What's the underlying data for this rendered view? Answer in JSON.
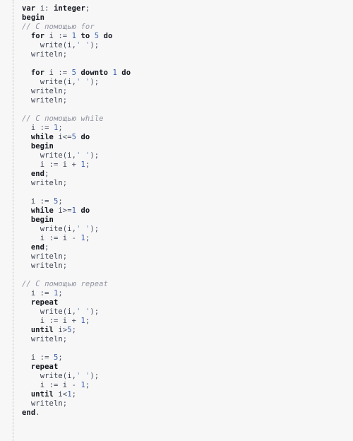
{
  "document": {
    "kind": "code-listing",
    "language": "Pascal",
    "colors": {
      "background": "#f7f7f8",
      "gutter_border": "#b9bcc4",
      "keyword": "#13161d",
      "comment": "#9295a0",
      "number": "#3d5fa6",
      "string": "#6f8dbe",
      "identifier": "#3c4250",
      "punctuation": "#4a5060"
    },
    "lines": [
      {
        "indent": 0,
        "tokens": [
          {
            "t": "var",
            "c": "kw"
          },
          {
            "t": " ",
            "c": "pun"
          },
          {
            "t": "i",
            "c": "id"
          },
          {
            "t": ": ",
            "c": "pun"
          },
          {
            "t": "integer",
            "c": "kw"
          },
          {
            "t": ";",
            "c": "pun"
          }
        ]
      },
      {
        "indent": 0,
        "tokens": [
          {
            "t": "begin",
            "c": "kw"
          }
        ]
      },
      {
        "indent": 0,
        "tokens": [
          {
            "t": "// С помощью for",
            "c": "cm"
          }
        ]
      },
      {
        "indent": 1,
        "tokens": [
          {
            "t": "for",
            "c": "kw"
          },
          {
            "t": " ",
            "c": "pun"
          },
          {
            "t": "i",
            "c": "id"
          },
          {
            "t": " := ",
            "c": "pun"
          },
          {
            "t": "1",
            "c": "num"
          },
          {
            "t": " ",
            "c": "pun"
          },
          {
            "t": "to",
            "c": "kw"
          },
          {
            "t": " ",
            "c": "pun"
          },
          {
            "t": "5",
            "c": "num"
          },
          {
            "t": " ",
            "c": "pun"
          },
          {
            "t": "do",
            "c": "kw"
          }
        ]
      },
      {
        "indent": 2,
        "tokens": [
          {
            "t": "write",
            "c": "id"
          },
          {
            "t": "(",
            "c": "pun"
          },
          {
            "t": "i",
            "c": "id"
          },
          {
            "t": ",",
            "c": "pun"
          },
          {
            "t": "' '",
            "c": "str"
          },
          {
            "t": ");",
            "c": "pun"
          }
        ]
      },
      {
        "indent": 1,
        "tokens": [
          {
            "t": "writeln",
            "c": "id"
          },
          {
            "t": ";",
            "c": "pun"
          }
        ]
      },
      {
        "indent": 0,
        "tokens": []
      },
      {
        "indent": 1,
        "tokens": [
          {
            "t": "for",
            "c": "kw"
          },
          {
            "t": " ",
            "c": "pun"
          },
          {
            "t": "i",
            "c": "id"
          },
          {
            "t": " := ",
            "c": "pun"
          },
          {
            "t": "5",
            "c": "num"
          },
          {
            "t": " ",
            "c": "pun"
          },
          {
            "t": "downto",
            "c": "kw"
          },
          {
            "t": " ",
            "c": "pun"
          },
          {
            "t": "1",
            "c": "num"
          },
          {
            "t": " ",
            "c": "pun"
          },
          {
            "t": "do",
            "c": "kw"
          }
        ]
      },
      {
        "indent": 2,
        "tokens": [
          {
            "t": "write",
            "c": "id"
          },
          {
            "t": "(",
            "c": "pun"
          },
          {
            "t": "i",
            "c": "id"
          },
          {
            "t": ",",
            "c": "pun"
          },
          {
            "t": "' '",
            "c": "str"
          },
          {
            "t": ");",
            "c": "pun"
          }
        ]
      },
      {
        "indent": 1,
        "tokens": [
          {
            "t": "writeln",
            "c": "id"
          },
          {
            "t": ";",
            "c": "pun"
          }
        ]
      },
      {
        "indent": 1,
        "tokens": [
          {
            "t": "writeln",
            "c": "id"
          },
          {
            "t": ";",
            "c": "pun"
          }
        ]
      },
      {
        "indent": 0,
        "tokens": []
      },
      {
        "indent": 0,
        "tokens": [
          {
            "t": "// С помощью while",
            "c": "cm"
          }
        ]
      },
      {
        "indent": 1,
        "tokens": [
          {
            "t": "i",
            "c": "id"
          },
          {
            "t": " := ",
            "c": "pun"
          },
          {
            "t": "1",
            "c": "num"
          },
          {
            "t": ";",
            "c": "pun"
          }
        ]
      },
      {
        "indent": 1,
        "tokens": [
          {
            "t": "while",
            "c": "kw"
          },
          {
            "t": " ",
            "c": "pun"
          },
          {
            "t": "i",
            "c": "id"
          },
          {
            "t": "<=",
            "c": "pun"
          },
          {
            "t": "5",
            "c": "num"
          },
          {
            "t": " ",
            "c": "pun"
          },
          {
            "t": "do",
            "c": "kw"
          }
        ]
      },
      {
        "indent": 1,
        "tokens": [
          {
            "t": "begin",
            "c": "kw"
          }
        ]
      },
      {
        "indent": 2,
        "tokens": [
          {
            "t": "write",
            "c": "id"
          },
          {
            "t": "(",
            "c": "pun"
          },
          {
            "t": "i",
            "c": "id"
          },
          {
            "t": ",",
            "c": "pun"
          },
          {
            "t": "' '",
            "c": "str"
          },
          {
            "t": ");",
            "c": "pun"
          }
        ]
      },
      {
        "indent": 2,
        "tokens": [
          {
            "t": "i",
            "c": "id"
          },
          {
            "t": " := ",
            "c": "pun"
          },
          {
            "t": "i",
            "c": "id"
          },
          {
            "t": " + ",
            "c": "pun"
          },
          {
            "t": "1",
            "c": "num"
          },
          {
            "t": ";",
            "c": "pun"
          }
        ]
      },
      {
        "indent": 1,
        "tokens": [
          {
            "t": "end",
            "c": "kw"
          },
          {
            "t": ";",
            "c": "pun"
          }
        ]
      },
      {
        "indent": 1,
        "tokens": [
          {
            "t": "writeln",
            "c": "id"
          },
          {
            "t": ";",
            "c": "pun"
          }
        ]
      },
      {
        "indent": 0,
        "tokens": []
      },
      {
        "indent": 1,
        "tokens": [
          {
            "t": "i",
            "c": "id"
          },
          {
            "t": " := ",
            "c": "pun"
          },
          {
            "t": "5",
            "c": "num"
          },
          {
            "t": ";",
            "c": "pun"
          }
        ]
      },
      {
        "indent": 1,
        "tokens": [
          {
            "t": "while",
            "c": "kw"
          },
          {
            "t": " ",
            "c": "pun"
          },
          {
            "t": "i",
            "c": "id"
          },
          {
            "t": ">=",
            "c": "pun"
          },
          {
            "t": "1",
            "c": "num"
          },
          {
            "t": " ",
            "c": "pun"
          },
          {
            "t": "do",
            "c": "kw"
          }
        ]
      },
      {
        "indent": 1,
        "tokens": [
          {
            "t": "begin",
            "c": "kw"
          }
        ]
      },
      {
        "indent": 2,
        "tokens": [
          {
            "t": "write",
            "c": "id"
          },
          {
            "t": "(",
            "c": "pun"
          },
          {
            "t": "i",
            "c": "id"
          },
          {
            "t": ",",
            "c": "pun"
          },
          {
            "t": "' '",
            "c": "str"
          },
          {
            "t": ");",
            "c": "pun"
          }
        ]
      },
      {
        "indent": 2,
        "tokens": [
          {
            "t": "i",
            "c": "id"
          },
          {
            "t": " := ",
            "c": "pun"
          },
          {
            "t": "i",
            "c": "id"
          },
          {
            "t": " - ",
            "c": "pun"
          },
          {
            "t": "1",
            "c": "num"
          },
          {
            "t": ";",
            "c": "pun"
          }
        ]
      },
      {
        "indent": 1,
        "tokens": [
          {
            "t": "end",
            "c": "kw"
          },
          {
            "t": ";",
            "c": "pun"
          }
        ]
      },
      {
        "indent": 1,
        "tokens": [
          {
            "t": "writeln",
            "c": "id"
          },
          {
            "t": ";",
            "c": "pun"
          }
        ]
      },
      {
        "indent": 1,
        "tokens": [
          {
            "t": "writeln",
            "c": "id"
          },
          {
            "t": ";",
            "c": "pun"
          }
        ]
      },
      {
        "indent": 0,
        "tokens": []
      },
      {
        "indent": 0,
        "tokens": [
          {
            "t": "// С помощью repeat",
            "c": "cm"
          }
        ]
      },
      {
        "indent": 1,
        "tokens": [
          {
            "t": "i",
            "c": "id"
          },
          {
            "t": " := ",
            "c": "pun"
          },
          {
            "t": "1",
            "c": "num"
          },
          {
            "t": ";",
            "c": "pun"
          }
        ]
      },
      {
        "indent": 1,
        "tokens": [
          {
            "t": "repeat",
            "c": "kw"
          }
        ]
      },
      {
        "indent": 2,
        "tokens": [
          {
            "t": "write",
            "c": "id"
          },
          {
            "t": "(",
            "c": "pun"
          },
          {
            "t": "i",
            "c": "id"
          },
          {
            "t": ",",
            "c": "pun"
          },
          {
            "t": "' '",
            "c": "str"
          },
          {
            "t": ");",
            "c": "pun"
          }
        ]
      },
      {
        "indent": 2,
        "tokens": [
          {
            "t": "i",
            "c": "id"
          },
          {
            "t": " := ",
            "c": "pun"
          },
          {
            "t": "i",
            "c": "id"
          },
          {
            "t": " + ",
            "c": "pun"
          },
          {
            "t": "1",
            "c": "num"
          },
          {
            "t": ";",
            "c": "pun"
          }
        ]
      },
      {
        "indent": 1,
        "tokens": [
          {
            "t": "until",
            "c": "kw"
          },
          {
            "t": " ",
            "c": "pun"
          },
          {
            "t": "i",
            "c": "id"
          },
          {
            "t": ">",
            "c": "pun"
          },
          {
            "t": "5",
            "c": "num"
          },
          {
            "t": ";",
            "c": "pun"
          }
        ]
      },
      {
        "indent": 1,
        "tokens": [
          {
            "t": "writeln",
            "c": "id"
          },
          {
            "t": ";",
            "c": "pun"
          }
        ]
      },
      {
        "indent": 0,
        "tokens": []
      },
      {
        "indent": 1,
        "tokens": [
          {
            "t": "i",
            "c": "id"
          },
          {
            "t": " := ",
            "c": "pun"
          },
          {
            "t": "5",
            "c": "num"
          },
          {
            "t": ";",
            "c": "pun"
          }
        ]
      },
      {
        "indent": 1,
        "tokens": [
          {
            "t": "repeat",
            "c": "kw"
          }
        ]
      },
      {
        "indent": 2,
        "tokens": [
          {
            "t": "write",
            "c": "id"
          },
          {
            "t": "(",
            "c": "pun"
          },
          {
            "t": "i",
            "c": "id"
          },
          {
            "t": ",",
            "c": "pun"
          },
          {
            "t": "' '",
            "c": "str"
          },
          {
            "t": ");",
            "c": "pun"
          }
        ]
      },
      {
        "indent": 2,
        "tokens": [
          {
            "t": "i",
            "c": "id"
          },
          {
            "t": " := ",
            "c": "pun"
          },
          {
            "t": "i",
            "c": "id"
          },
          {
            "t": " - ",
            "c": "pun"
          },
          {
            "t": "1",
            "c": "num"
          },
          {
            "t": ";",
            "c": "pun"
          }
        ]
      },
      {
        "indent": 1,
        "tokens": [
          {
            "t": "until",
            "c": "kw"
          },
          {
            "t": " ",
            "c": "pun"
          },
          {
            "t": "i",
            "c": "id"
          },
          {
            "t": "<",
            "c": "pun"
          },
          {
            "t": "1",
            "c": "num"
          },
          {
            "t": ";",
            "c": "pun"
          }
        ]
      },
      {
        "indent": 1,
        "tokens": [
          {
            "t": "writeln",
            "c": "id"
          },
          {
            "t": ";",
            "c": "pun"
          }
        ]
      },
      {
        "indent": 0,
        "tokens": [
          {
            "t": "end",
            "c": "kw"
          },
          {
            "t": ".",
            "c": "pun"
          }
        ]
      }
    ]
  }
}
